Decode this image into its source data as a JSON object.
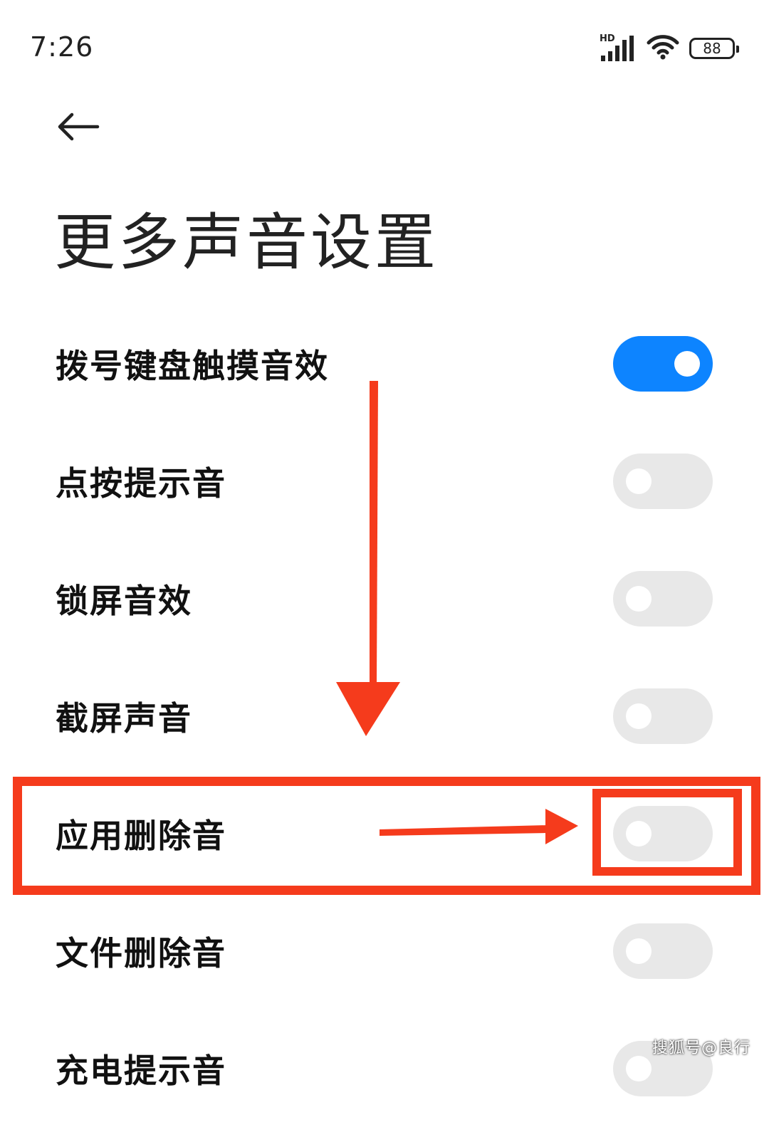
{
  "status_bar": {
    "time": "7:26",
    "network_label": "HD",
    "battery_level": "88"
  },
  "header": {
    "back_icon": "arrow-left-icon",
    "title": "更多声音设置"
  },
  "settings": [
    {
      "label": "拨号键盘触摸音效",
      "enabled": true
    },
    {
      "label": "点按提示音",
      "enabled": false
    },
    {
      "label": "锁屏音效",
      "enabled": false
    },
    {
      "label": "截屏声音",
      "enabled": false
    },
    {
      "label": "应用删除音",
      "enabled": false
    },
    {
      "label": "文件删除音",
      "enabled": false
    },
    {
      "label": "充电提示音",
      "enabled": false
    }
  ],
  "colors": {
    "toggle_on": "#0d84ff",
    "toggle_off": "#e8e8e8",
    "annotation": "#f53b1c"
  },
  "watermark": "搜狐号@良行"
}
